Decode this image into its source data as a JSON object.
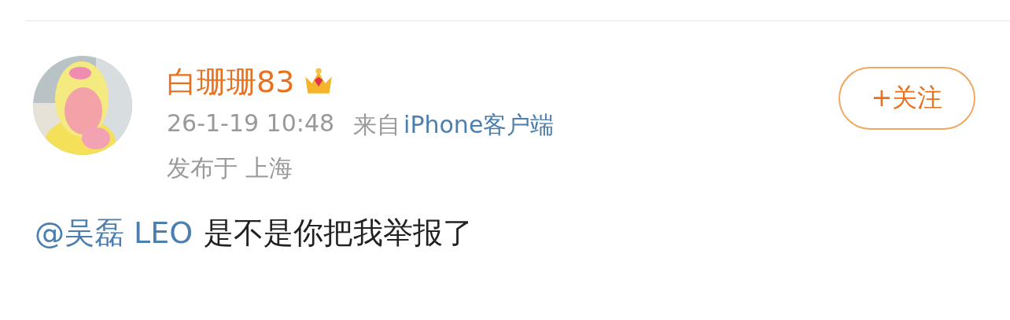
{
  "post": {
    "author": {
      "name": "白珊珊83"
    },
    "time": "26-1-19 10:48",
    "source_prefix": "来自",
    "source": "iPhone客户端",
    "location": "发布于 上海",
    "follow_button": {
      "label": "+关注"
    },
    "content": {
      "mention": "@吴磊 LEO",
      "text": "是不是你把我举报了"
    }
  }
}
